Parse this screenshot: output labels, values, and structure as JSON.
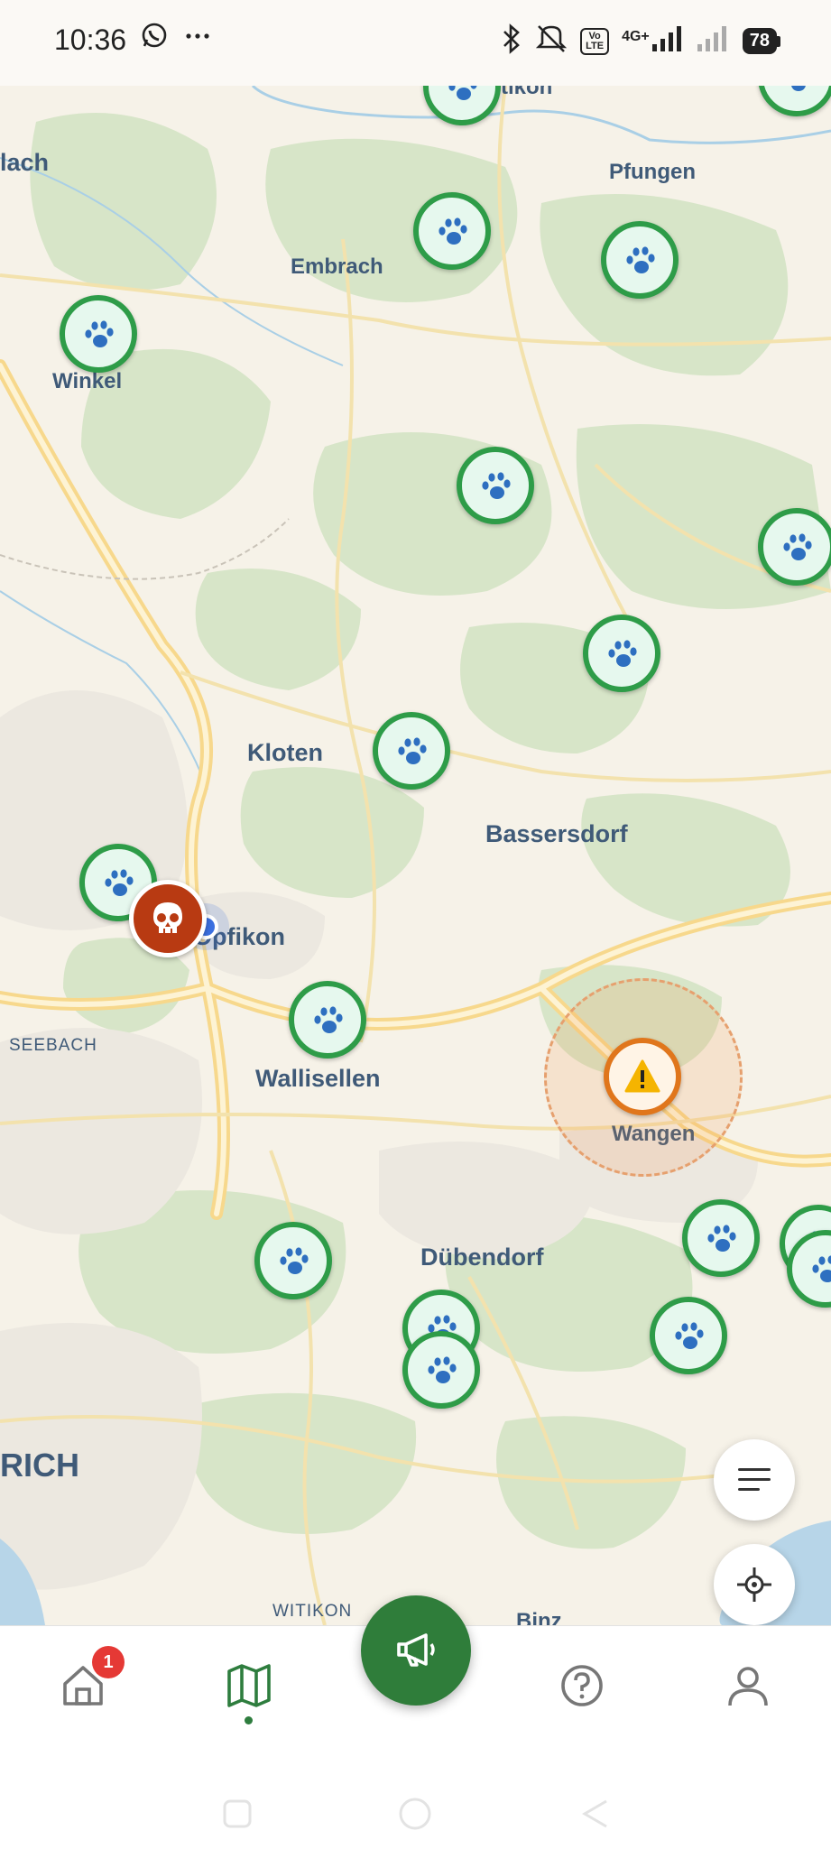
{
  "status_bar": {
    "time": "10:36",
    "left_icons": [
      "whatsapp-icon",
      "more-dots-icon"
    ],
    "volte": "Vo LTE",
    "network": "4G+",
    "battery": "78"
  },
  "map": {
    "places": [
      {
        "id": "lach",
        "label": "lach"
      },
      {
        "id": "pfungen",
        "label": "Pfungen"
      },
      {
        "id": "embrach",
        "label": "Embrach"
      },
      {
        "id": "winkel",
        "label": "Winkel"
      },
      {
        "id": "kloten",
        "label": "Kloten"
      },
      {
        "id": "bassersdorf",
        "label": "Bassersdorf"
      },
      {
        "id": "opfikon",
        "label": "Opfikon"
      },
      {
        "id": "seebach",
        "label": "SEEBACH"
      },
      {
        "id": "wallisellen",
        "label": "Wallisellen"
      },
      {
        "id": "wangen",
        "label": "Wangen"
      },
      {
        "id": "dubendorf",
        "label": "Dübendorf"
      },
      {
        "id": "zurich",
        "label": "RICH"
      },
      {
        "id": "witikon",
        "label": "WITIKON"
      },
      {
        "id": "binz",
        "label": "Binz"
      },
      {
        "id": "top",
        "label": "tikon"
      }
    ],
    "markers": {
      "animal_sightings": 19,
      "dead_animal": 1,
      "warning": 1
    },
    "controls": {
      "filter": "list-filter-icon",
      "locate": "crosshair-locate-icon"
    }
  },
  "nav": {
    "home_badge": "1",
    "items": [
      "home-icon",
      "map-icon",
      "megaphone-icon",
      "help-icon",
      "profile-icon"
    ],
    "active": "map"
  },
  "colors": {
    "brand_green": "#2f7d3a",
    "marker_green": "#2e9c48",
    "warning_orange": "#e0761c",
    "danger_red": "#b83a12"
  }
}
